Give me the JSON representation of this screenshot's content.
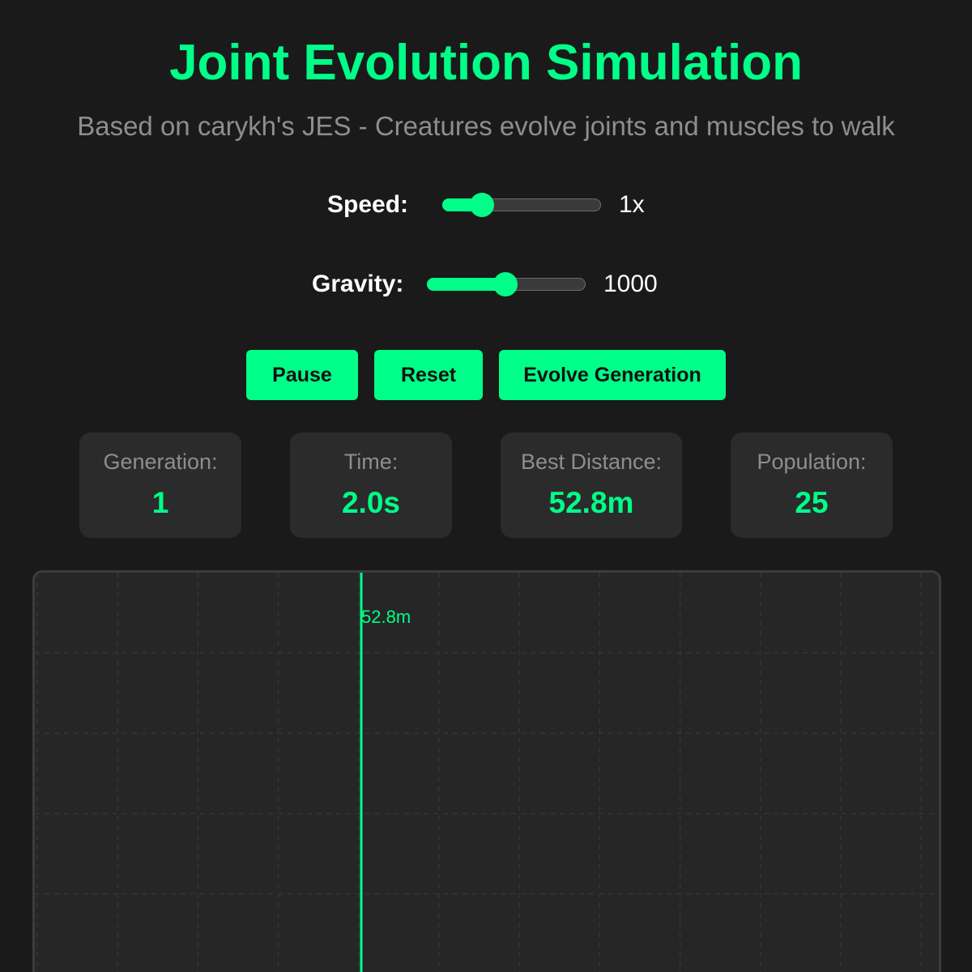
{
  "header": {
    "title": "Joint Evolution Simulation",
    "subtitle": "Based on carykh's JES - Creatures evolve joints and muscles to walk"
  },
  "controls": {
    "speed": {
      "label": "Speed:",
      "value_text": "1x",
      "level": 0.25
    },
    "gravity": {
      "label": "Gravity:",
      "value_text": "1000",
      "level": 0.5
    }
  },
  "buttons": {
    "pause_label": "Pause",
    "reset_label": "Reset",
    "evolve_label": "Evolve Generation"
  },
  "stats": {
    "generation": {
      "label": "Generation:",
      "value": "1"
    },
    "time": {
      "label": "Time:",
      "value": "2.0s"
    },
    "best_distance": {
      "label": "Best Distance:",
      "value": "52.8m"
    },
    "population": {
      "label": "Population:",
      "value": "25"
    }
  },
  "simulation": {
    "best_marker_label": "52.8m",
    "grid": true
  },
  "colors": {
    "accent": "#00ff88",
    "background": "#1a1a1a",
    "panel": "#2b2b2b",
    "muted_text": "#8e8e8e"
  }
}
